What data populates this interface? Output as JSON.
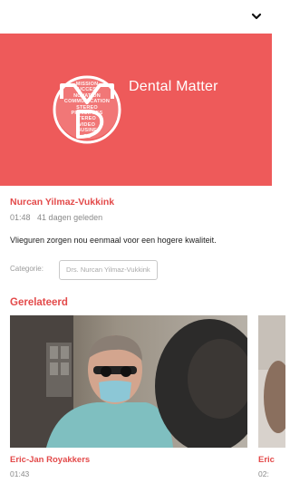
{
  "header": {
    "collapse_icon": "chevron-down-icon"
  },
  "hero": {
    "brand_name": "Dental Matter",
    "logo_words": [
      "MISSION",
      "UCCES",
      "NOVATION",
      "COMMUNICATION",
      "STEREO",
      "PRINCIPLES",
      "TEREO",
      "VIDEO",
      "BUSINE",
      "CE"
    ],
    "colors": {
      "background": "#ee5a5a",
      "logo": "#ffffff"
    }
  },
  "video": {
    "author": "Nurcan Yilmaz-Vukkink",
    "duration": "01:48",
    "age": "41 dagen geleden",
    "description": "Vlieguren zorgen nou eenmaal voor een hogere kwaliteit.",
    "category_label": "Categorie:",
    "category_value": "Drs. Nurcan Yilmaz-Vukkink"
  },
  "related": {
    "title": "Gerelateerd",
    "items": [
      {
        "name": "Eric-Jan Royakkers",
        "duration": "01:43"
      },
      {
        "name": "Eric",
        "duration": "02:"
      }
    ]
  },
  "colors": {
    "accent": "#e34a4a",
    "muted": "#8a8a8a"
  }
}
